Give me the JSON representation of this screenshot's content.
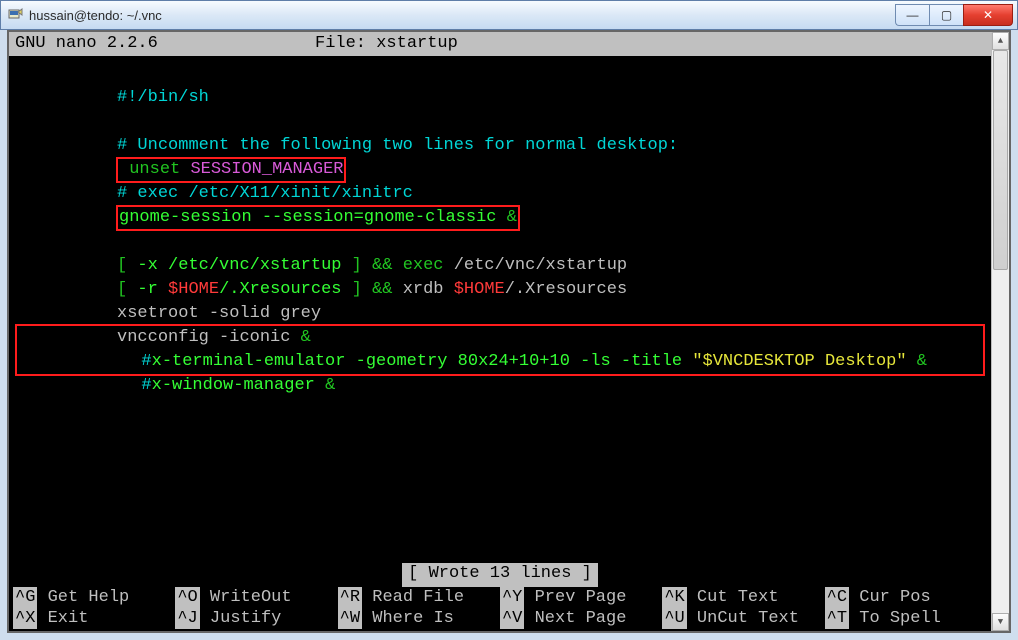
{
  "window": {
    "title": "hussain@tendo: ~/.vnc"
  },
  "win_controls": {
    "min": "—",
    "max": "▢",
    "close": "✕"
  },
  "nano": {
    "version": "  GNU nano 2.2.6",
    "file_label": "File: xstartup",
    "status": "[ Wrote 13 lines ]"
  },
  "file": {
    "l1": "#!/bin/sh",
    "l2": "",
    "l3_a": "#",
    "l3_b": " Uncomment the following two lines for normal desktop:",
    "l4_a": " unset",
    "l4_b": " SESSION_MANAGER",
    "l5_a": "#",
    "l5_b": " exec /etc/X11/xinit/xinitrc",
    "l6_a": "gnome-session --session=gnome-classic ",
    "l6_b": "&",
    "l7": "",
    "l8_a": "[",
    "l8_b": " -x /etc/vnc/xstartup ",
    "l8_c": "]",
    "l8_d": " ",
    "l8_e": "&&",
    "l8_f": " ",
    "l8_g": "exec",
    "l8_h": " /etc/vnc/xstartup",
    "l9_a": "[",
    "l9_b": " -r ",
    "l9_c": "$HOME",
    "l9_d": "/.Xresources ",
    "l9_e": "]",
    "l9_f": " ",
    "l9_g": "&&",
    "l9_h": " xrdb ",
    "l9_i": "$HOME",
    "l9_j": "/.Xresources",
    "l10": "xsetroot -solid grey",
    "l11_a": "vncconfig -iconic ",
    "l11_b": "&",
    "l12_a": "#",
    "l12_b": "x-terminal-emulator -geometry 80x24+10+10 -ls -title ",
    "l12_c": "\"$VNCDESKTOP Desktop\"",
    "l12_d": " ",
    "l12_e": "&",
    "l13_a": "#",
    "l13_b": "x-window-manager ",
    "l13_c": "&"
  },
  "shortcuts": {
    "row1": [
      {
        "k": "^G",
        "t": " Get Help"
      },
      {
        "k": "^O",
        "t": " WriteOut"
      },
      {
        "k": "^R",
        "t": " Read File"
      },
      {
        "k": "^Y",
        "t": " Prev Page"
      },
      {
        "k": "^K",
        "t": " Cut Text"
      },
      {
        "k": "^C",
        "t": " Cur Pos"
      }
    ],
    "row2": [
      {
        "k": "^X",
        "t": " Exit"
      },
      {
        "k": "^J",
        "t": " Justify"
      },
      {
        "k": "^W",
        "t": " Where Is"
      },
      {
        "k": "^V",
        "t": " Next Page"
      },
      {
        "k": "^U",
        "t": " UnCut Text"
      },
      {
        "k": "^T",
        "t": " To Spell"
      }
    ]
  },
  "scrollbar": {
    "up": "▲",
    "down": "▼"
  }
}
